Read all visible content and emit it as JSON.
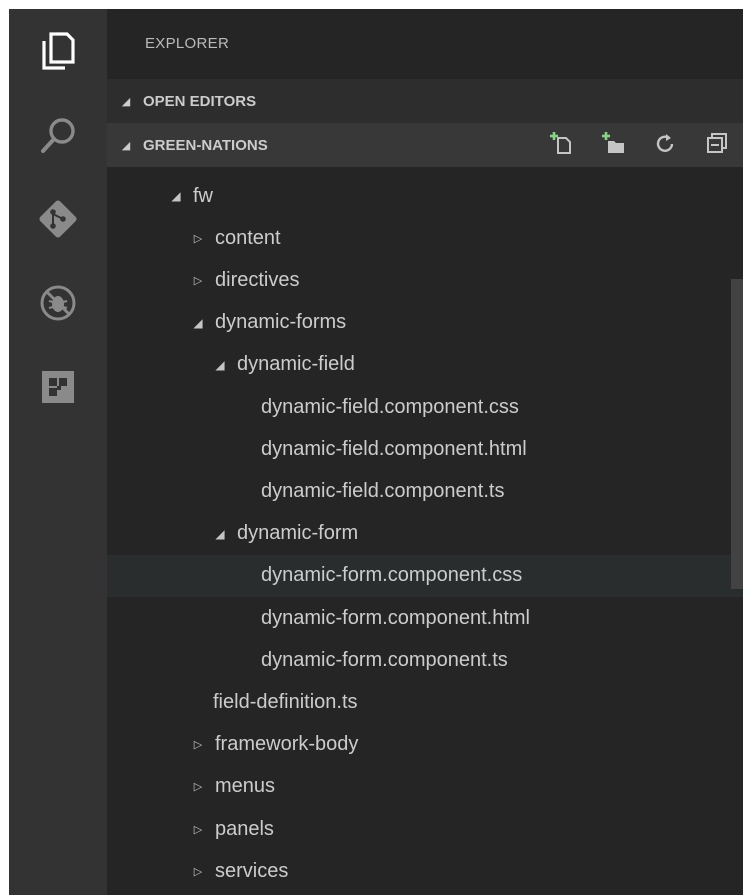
{
  "window": {
    "accent_bg": "#252526",
    "activity_bg": "#333333"
  },
  "activitybar": {
    "items": [
      {
        "icon": "files-icon"
      },
      {
        "icon": "search-icon"
      },
      {
        "icon": "source-control-icon"
      },
      {
        "icon": "debug-icon"
      },
      {
        "icon": "extensions-icon"
      }
    ]
  },
  "sidebar": {
    "title": "EXPLORER",
    "open_editors": {
      "label": "OPEN EDITORS"
    },
    "workspace": {
      "label": "GREEN-NATIONS",
      "actions": [
        "new-file-icon",
        "new-folder-icon",
        "refresh-icon",
        "collapse-all-icon"
      ]
    },
    "tree": [
      {
        "label": "fw",
        "depth": 0,
        "state": "expanded"
      },
      {
        "label": "content",
        "depth": 1,
        "state": "collapsed"
      },
      {
        "label": "directives",
        "depth": 1,
        "state": "collapsed"
      },
      {
        "label": "dynamic-forms",
        "depth": 1,
        "state": "expanded"
      },
      {
        "label": "dynamic-field",
        "depth": 2,
        "state": "expanded"
      },
      {
        "label": "dynamic-field.component.css",
        "depth": 3,
        "state": "file"
      },
      {
        "label": "dynamic-field.component.html",
        "depth": 3,
        "state": "file"
      },
      {
        "label": "dynamic-field.component.ts",
        "depth": 3,
        "state": "file"
      },
      {
        "label": "dynamic-form",
        "depth": 2,
        "state": "expanded"
      },
      {
        "label": "dynamic-form.component.css",
        "depth": 3,
        "state": "file",
        "selected": true
      },
      {
        "label": "dynamic-form.component.html",
        "depth": 3,
        "state": "file"
      },
      {
        "label": "dynamic-form.component.ts",
        "depth": 3,
        "state": "file"
      },
      {
        "label": "field-definition.ts",
        "depth": 2,
        "state": "file"
      },
      {
        "label": "framework-body",
        "depth": 1,
        "state": "collapsed"
      },
      {
        "label": "menus",
        "depth": 1,
        "state": "collapsed"
      },
      {
        "label": "panels",
        "depth": 1,
        "state": "collapsed"
      },
      {
        "label": "services",
        "depth": 1,
        "state": "collapsed"
      }
    ]
  }
}
